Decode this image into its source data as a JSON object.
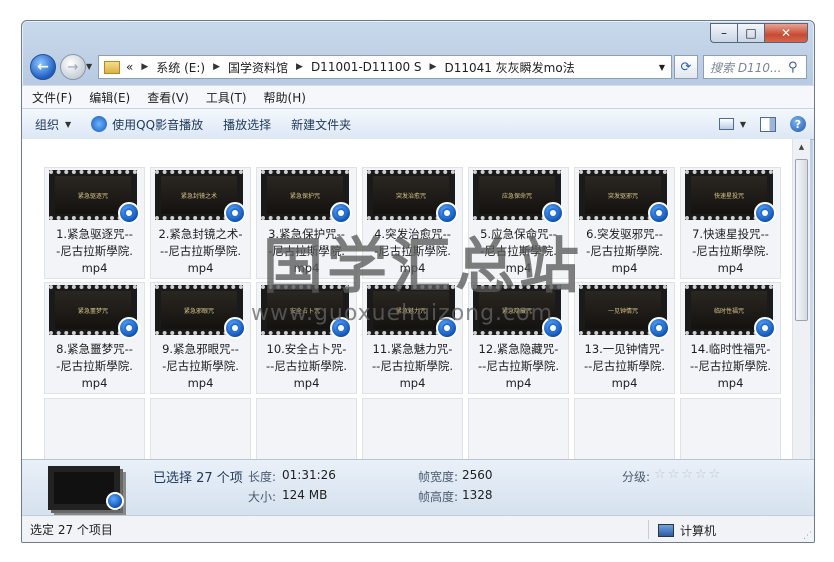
{
  "window": {
    "caption": {
      "minimize": "–",
      "maximize": "□",
      "close": "✕"
    }
  },
  "nav": {
    "back_icon": "back-arrow-icon",
    "forward_icon": "forward-arrow-icon",
    "breadcrumb": [
      "系统 (E:)",
      "国学资料馆",
      "D11001-D11100 S",
      "D11041 灰灰瞬发mo法"
    ],
    "breadcrumb_prefix": "«",
    "search_placeholder": "搜索 D110..."
  },
  "menu": [
    "文件(F)",
    "编辑(E)",
    "查看(V)",
    "工具(T)",
    "帮助(H)"
  ],
  "toolbar": {
    "organize": "组织",
    "play_qq": "使用QQ影音播放",
    "play_selection": "播放选择",
    "new_folder": "新建文件夹"
  },
  "files": [
    {
      "name": "1.紧急驱逐咒---尼古拉斯學院.mp4",
      "thumb": "紧急驱逐咒"
    },
    {
      "name": "2.紧急封镜之术---尼古拉斯學院.mp4",
      "thumb": "紧急封镜之术"
    },
    {
      "name": "3.紧急保护咒---尼古拉斯學院.mp4",
      "thumb": "紧急保护咒"
    },
    {
      "name": "4.突发治愈咒---尼古拉斯學院.mp4",
      "thumb": "突发治愈咒"
    },
    {
      "name": "5.应急保命咒---尼古拉斯學院.mp4",
      "thumb": "应急保命咒"
    },
    {
      "name": "6.突发驱邪咒---尼古拉斯學院.mp4",
      "thumb": "突发驱邪咒"
    },
    {
      "name": "7.快速星投咒---尼古拉斯學院.mp4",
      "thumb": "快速星投咒"
    },
    {
      "name": "8.紧急噩梦咒---尼古拉斯學院.mp4",
      "thumb": "紧急噩梦咒"
    },
    {
      "name": "9.紧急邪眼咒---尼古拉斯學院.mp4",
      "thumb": "紧急邪眼咒"
    },
    {
      "name": "10.安全占卜咒---尼古拉斯學院.mp4",
      "thumb": "安全占卜咒"
    },
    {
      "name": "11.紧急魅力咒---尼古拉斯學院.mp4",
      "thumb": "紧急魅力咒"
    },
    {
      "name": "12.紧急隐藏咒---尼古拉斯學院.mp4",
      "thumb": "紧急隐藏咒"
    },
    {
      "name": "13.一见钟情咒---尼古拉斯學院.mp4",
      "thumb": "一见钟情咒"
    },
    {
      "name": "14.临时性福咒---尼古拉斯學院.mp4",
      "thumb": "临时性福咒"
    }
  ],
  "details": {
    "selected": "已选择 27 个项",
    "length_label": "长度:",
    "length_value": "01:31:26",
    "size_label": "大小:",
    "size_value": "124 MB",
    "frame_width_label": "帧宽度:",
    "frame_width_value": "2560",
    "frame_height_label": "帧高度:",
    "frame_height_value": "1328",
    "rating_label": "分级:",
    "rating": 0
  },
  "status": {
    "left": "选定 27 个项目",
    "computer": "计算机"
  },
  "watermark": {
    "main": "国学汇总站",
    "url": "www.guoxuehuizong.com"
  }
}
